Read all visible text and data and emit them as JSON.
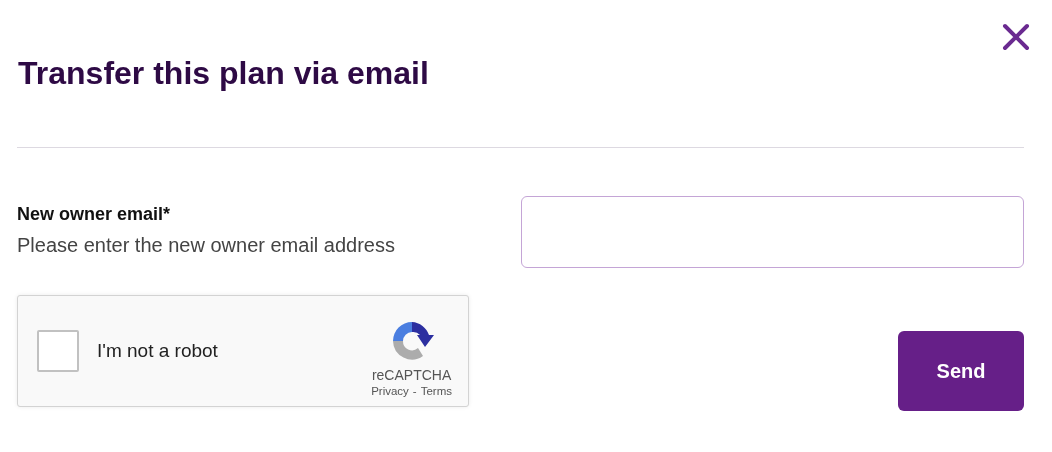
{
  "title": "Transfer this plan via email",
  "email_field": {
    "label": "New owner email*",
    "hint": "Please enter the new owner email address"
  },
  "captcha": {
    "label": "I'm not a robot",
    "checked": false,
    "brand": "reCAPTCHA",
    "privacy": "Privacy",
    "separator": "-",
    "terms": "Terms"
  },
  "buttons": [
    {
      "label": "Send",
      "kind": "primary"
    }
  ]
}
